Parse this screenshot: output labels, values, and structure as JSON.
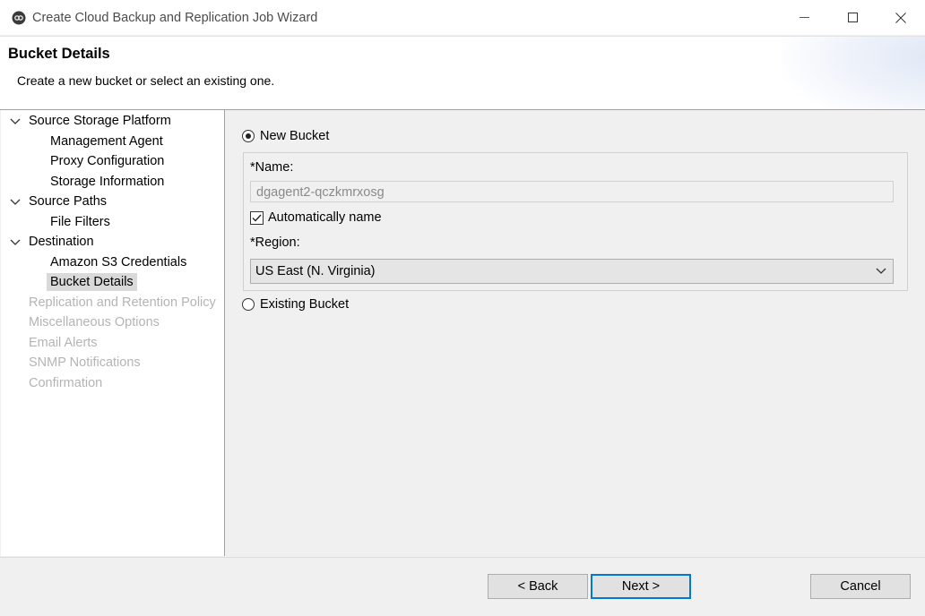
{
  "window": {
    "title": "Create Cloud Backup and Replication Job Wizard",
    "controls": {
      "minimize": "—",
      "maximize": "☐",
      "close": "✕"
    }
  },
  "banner": {
    "title": "Bucket Details",
    "subtitle": "Create a new bucket or select an existing one."
  },
  "nav": {
    "items": [
      {
        "label": "Source Storage Platform"
      },
      {
        "label": "Management Agent"
      },
      {
        "label": "Proxy Configuration"
      },
      {
        "label": "Storage Information"
      },
      {
        "label": "Source Paths"
      },
      {
        "label": "File Filters"
      },
      {
        "label": "Destination"
      },
      {
        "label": "Amazon S3 Credentials"
      },
      {
        "label": "Bucket Details"
      },
      {
        "label": "Replication and Retention Policy"
      },
      {
        "label": "Miscellaneous Options"
      },
      {
        "label": "Email Alerts"
      },
      {
        "label": "SNMP Notifications"
      },
      {
        "label": "Confirmation"
      }
    ]
  },
  "form": {
    "new_bucket_label": "New Bucket",
    "new_bucket_selected": true,
    "name_label": "*Name:",
    "name_value": "dgagent2-qczkmrxosg",
    "auto_name_label": "Automatically name",
    "auto_name_checked": true,
    "region_label": "*Region:",
    "region_value": "US East (N. Virginia)",
    "existing_bucket_label": "Existing Bucket",
    "existing_bucket_selected": false
  },
  "footer": {
    "back_label": "< Back",
    "next_label": "Next >",
    "cancel_label": "Cancel"
  },
  "colors": {
    "default_button_border": "#0078d7",
    "disabled_text": "#b4b4b4",
    "selected_bg": "#d9d9d9"
  }
}
